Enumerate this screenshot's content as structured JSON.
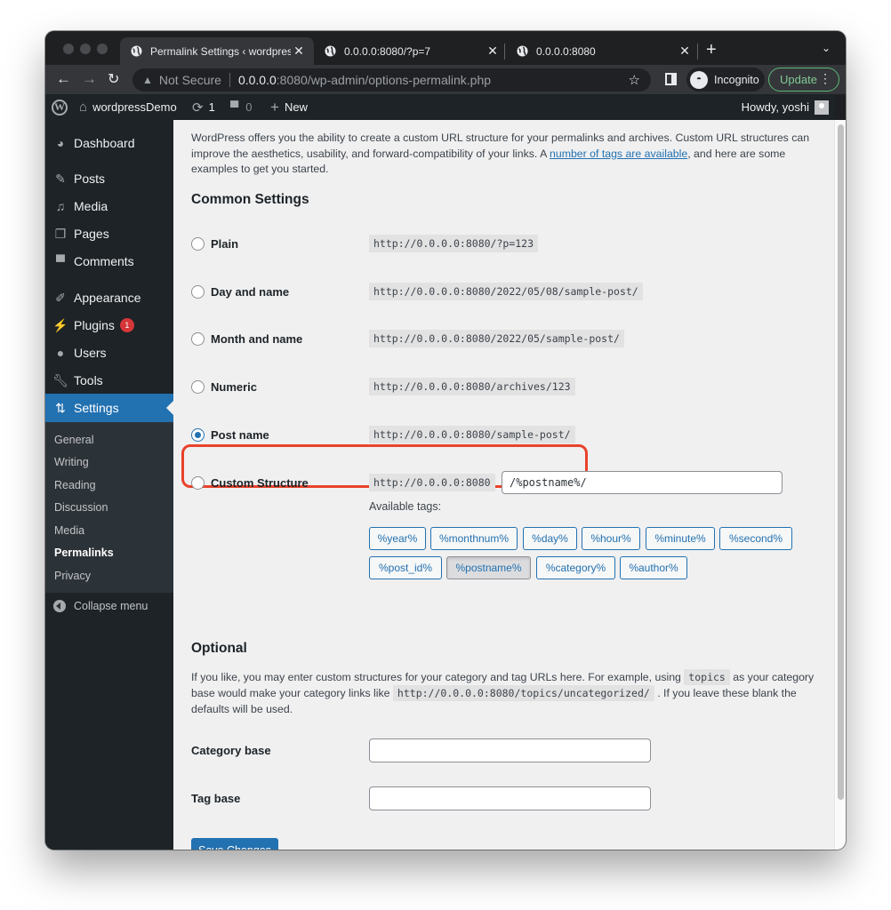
{
  "browser": {
    "tabs": [
      {
        "title": "Permalink Settings ‹ wordpressDemo",
        "active": true
      },
      {
        "title": "0.0.0.0:8080/?p=7",
        "active": false
      },
      {
        "title": "0.0.0.0:8080",
        "active": false
      }
    ],
    "new_tab_icon": "+",
    "tab_menu_icon": "⌄",
    "address": {
      "security_label": "Not Secure",
      "host": "0.0.0.0",
      "path": ":8080/wp-admin/options-permalink.php"
    },
    "incognito_label": "Incognito",
    "update_label": "Update"
  },
  "adminbar": {
    "site_name": "wordpressDemo",
    "updates_count": "1",
    "comments_count": "0",
    "new_label": "New",
    "greeting": "Howdy, yoshi"
  },
  "sidebar": {
    "items": [
      {
        "label": "Dashboard",
        "icon": "dashboard-icon"
      },
      {
        "label": "Posts",
        "icon": "pin-icon"
      },
      {
        "label": "Media",
        "icon": "media-icon"
      },
      {
        "label": "Pages",
        "icon": "pages-icon"
      },
      {
        "label": "Comments",
        "icon": "comment-icon"
      },
      {
        "label": "Appearance",
        "icon": "brush-icon"
      },
      {
        "label": "Plugins",
        "icon": "plugin-icon",
        "badge": "1"
      },
      {
        "label": "Users",
        "icon": "user-icon"
      },
      {
        "label": "Tools",
        "icon": "wrench-icon"
      },
      {
        "label": "Settings",
        "icon": "settings-icon",
        "current": true
      }
    ],
    "submenu": [
      {
        "label": "General"
      },
      {
        "label": "Writing"
      },
      {
        "label": "Reading"
      },
      {
        "label": "Discussion"
      },
      {
        "label": "Media"
      },
      {
        "label": "Permalinks",
        "current": true
      },
      {
        "label": "Privacy"
      }
    ],
    "collapse_label": "Collapse menu"
  },
  "main": {
    "intro_before": "WordPress offers you the ability to create a custom URL structure for your permalinks and archives. Custom URL structures can improve the aesthetics, usability, and forward-compatibility of your links. A ",
    "intro_link": "number of tags are available",
    "intro_after": ", and here are some examples to get you started.",
    "common_heading": "Common Settings",
    "options": [
      {
        "label": "Plain",
        "example": "http://0.0.0.0:8080/?p=123",
        "checked": false
      },
      {
        "label": "Day and name",
        "example": "http://0.0.0.0:8080/2022/05/08/sample-post/",
        "checked": false
      },
      {
        "label": "Month and name",
        "example": "http://0.0.0.0:8080/2022/05/sample-post/",
        "checked": false
      },
      {
        "label": "Numeric",
        "example": "http://0.0.0.0:8080/archives/123",
        "checked": false
      },
      {
        "label": "Post name",
        "example": "http://0.0.0.0:8080/sample-post/",
        "checked": true
      },
      {
        "label": "Custom Structure",
        "example": "http://0.0.0.0:8080",
        "checked": false
      }
    ],
    "custom_structure_value": "/%postname%/",
    "available_tags_label": "Available tags:",
    "tags": [
      "%year%",
      "%monthnum%",
      "%day%",
      "%hour%",
      "%minute%",
      "%second%",
      "%post_id%",
      "%postname%",
      "%category%",
      "%author%"
    ],
    "active_tag": "%postname%",
    "optional_heading": "Optional",
    "optional_text_1": "If you like, you may enter custom structures for your category and tag URLs here. For example, using ",
    "optional_code_1": "topics",
    "optional_text_2": " as your category base would make your category links like ",
    "optional_code_2": "http://0.0.0.0:8080/topics/uncategorized/",
    "optional_text_3": " . If you leave these blank the defaults will be used.",
    "category_base_label": "Category base",
    "category_base_value": "",
    "tag_base_label": "Tag base",
    "tag_base_value": "",
    "save_label": "Save Changes"
  },
  "colors": {
    "accent": "#2271b1",
    "highlight": "#e8432b",
    "admin_dark": "#1d2327",
    "badge": "#d63638"
  }
}
